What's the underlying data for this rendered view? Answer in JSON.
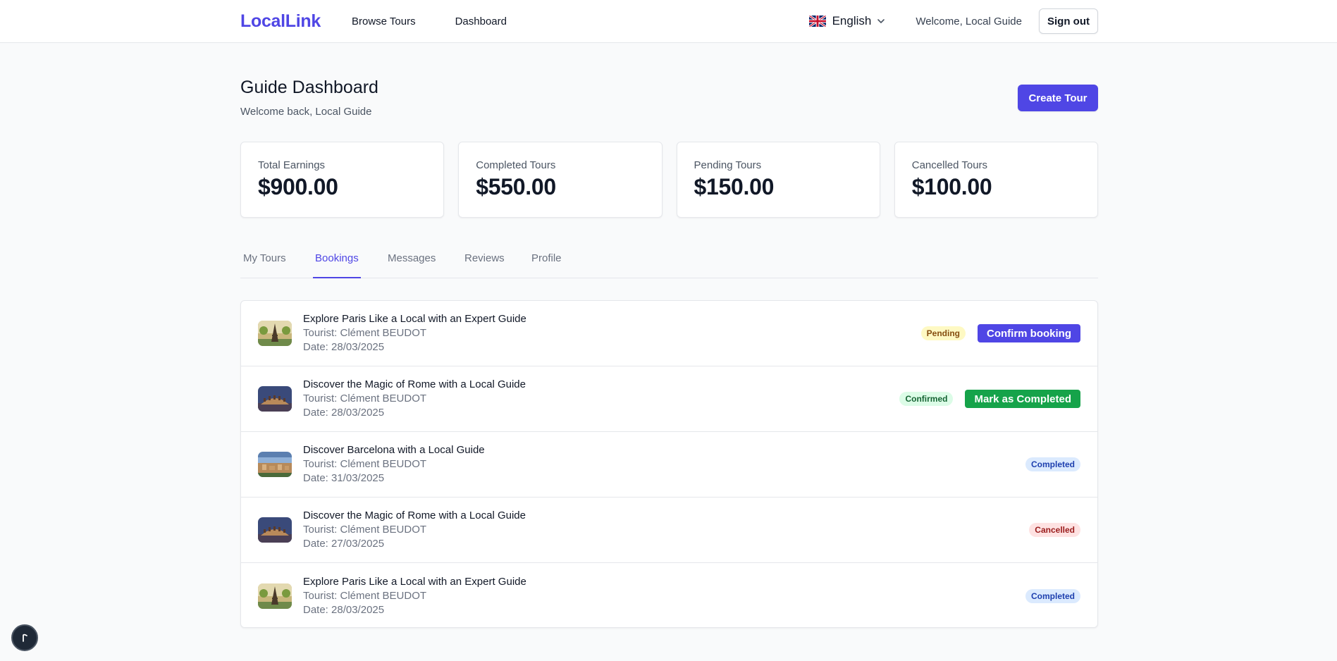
{
  "nav": {
    "logo": "LocalLink",
    "browse_label": "Browse Tours",
    "dashboard_label": "Dashboard",
    "language": "English",
    "welcome": "Welcome, Local Guide",
    "signout_label": "Sign out"
  },
  "header": {
    "title": "Guide Dashboard",
    "subtitle": "Welcome back, Local Guide",
    "create_label": "Create Tour"
  },
  "stats": [
    {
      "label": "Total Earnings",
      "value": "$900.00"
    },
    {
      "label": "Completed Tours",
      "value": "$550.00"
    },
    {
      "label": "Pending Tours",
      "value": "$150.00"
    },
    {
      "label": "Cancelled Tours",
      "value": "$100.00"
    }
  ],
  "tabs": [
    {
      "label": "My Tours"
    },
    {
      "label": "Bookings"
    },
    {
      "label": "Messages"
    },
    {
      "label": "Reviews"
    },
    {
      "label": "Profile"
    }
  ],
  "active_tab": "Bookings",
  "bookings": [
    {
      "title": "Explore Paris Like a Local with an Expert Guide",
      "tourist": "Tourist: Clément BEUDOT",
      "date": "Date: 28/03/2025",
      "status": "Pending",
      "action": "Confirm booking",
      "image": "paris-eiffel-icon"
    },
    {
      "title": "Discover the Magic of Rome with a Local Guide",
      "tourist": "Tourist: Clément BEUDOT",
      "date": "Date: 28/03/2025",
      "status": "Confirmed",
      "action": "Mark as Completed",
      "image": "rome-colosseum-icon"
    },
    {
      "title": "Discover Barcelona with a Local Guide",
      "tourist": "Tourist: Clément BEUDOT",
      "date": "Date: 31/03/2025",
      "status": "Completed",
      "action": "",
      "image": "barcelona-cityscape-icon"
    },
    {
      "title": "Discover the Magic of Rome with a Local Guide",
      "tourist": "Tourist: Clément BEUDOT",
      "date": "Date: 27/03/2025",
      "status": "Cancelled",
      "action": "",
      "image": "rome-colosseum-icon"
    },
    {
      "title": "Explore Paris Like a Local with an Expert Guide",
      "tourist": "Tourist: Clément BEUDOT",
      "date": "Date: 28/03/2025",
      "status": "Completed",
      "action": "",
      "image": "paris-eiffel-icon"
    }
  ],
  "colors": {
    "accent": "#4f46e5",
    "success": "#16a34a",
    "background": "#f9fafb"
  }
}
